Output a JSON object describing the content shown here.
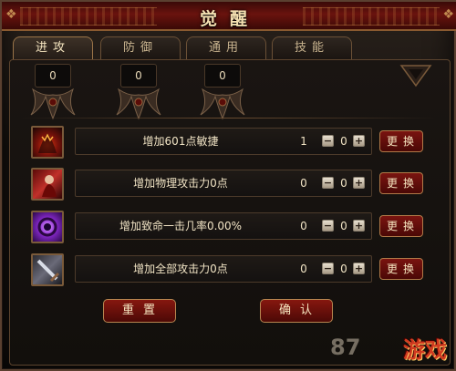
{
  "window": {
    "title": "觉醒"
  },
  "tabs": [
    {
      "label": "进攻",
      "active": true
    },
    {
      "label": "防御",
      "active": false
    },
    {
      "label": "通用",
      "active": false
    },
    {
      "label": "技能",
      "active": false
    }
  ],
  "sockets": [
    {
      "value": "0"
    },
    {
      "value": "0"
    },
    {
      "value": "0"
    }
  ],
  "rows": [
    {
      "icon": "flame-demon-icon",
      "desc": "增加601点敏捷",
      "current": "1",
      "add": "0",
      "swap_label": "更换"
    },
    {
      "icon": "red-warrior-icon",
      "desc": "增加物理攻击力0点",
      "current": "0",
      "add": "0",
      "swap_label": "更换"
    },
    {
      "icon": "purple-vortex-icon",
      "desc": "增加致命一击几率0.00%",
      "current": "0",
      "add": "0",
      "swap_label": "更换"
    },
    {
      "icon": "grey-blade-icon",
      "desc": "增加全部攻击力0点",
      "current": "0",
      "add": "0",
      "swap_label": "更换"
    }
  ],
  "buttons": {
    "reset": "重置",
    "confirm": "确认"
  },
  "watermark": {
    "number": "87",
    "logo": "游戏"
  },
  "colors": {
    "accent_red": "#7a1410",
    "gold_border": "#b07a48",
    "text": "#f1e4c5"
  }
}
